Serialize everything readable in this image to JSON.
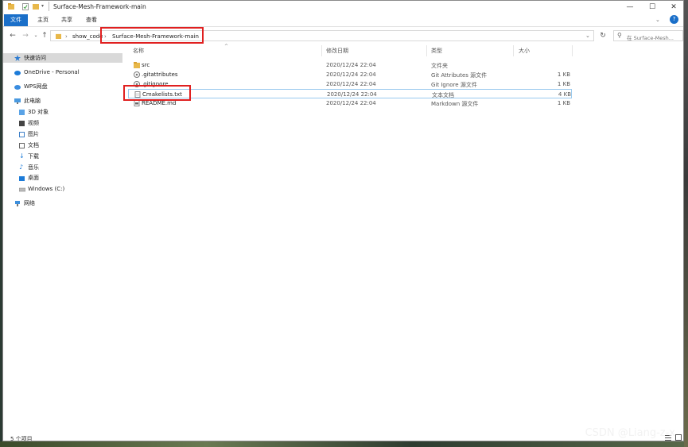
{
  "window": {
    "title": "Surface-Mesh-Framework-main",
    "controls": {
      "minimize": "—",
      "maximize": "☐",
      "close": "✕"
    }
  },
  "ribbon": {
    "tabs": [
      "文件",
      "主页",
      "共享",
      "查看"
    ],
    "help": "?"
  },
  "address": {
    "crumbs": [
      "show_code",
      "Surface-Mesh-Framework-main"
    ],
    "separator": "›",
    "search_placeholder": "在 Surface-Mesh..."
  },
  "nav": {
    "items": [
      {
        "label": "快速访问",
        "icon": "star-icon"
      },
      {
        "label": "OneDrive - Personal",
        "icon": "cloud-icon"
      },
      {
        "label": "WPS网盘",
        "icon": "wps-cloud-icon"
      },
      {
        "label": "此电脑",
        "icon": "computer-icon"
      },
      {
        "label": "3D 对象",
        "icon": "cube-icon"
      },
      {
        "label": "视频",
        "icon": "video-icon"
      },
      {
        "label": "图片",
        "icon": "picture-icon"
      },
      {
        "label": "文档",
        "icon": "document-icon"
      },
      {
        "label": "下载",
        "icon": "download-icon"
      },
      {
        "label": "音乐",
        "icon": "music-icon"
      },
      {
        "label": "桌面",
        "icon": "desktop-icon"
      },
      {
        "label": "Windows (C:)",
        "icon": "drive-icon"
      },
      {
        "label": "网络",
        "icon": "network-icon"
      }
    ]
  },
  "columns": {
    "name": "名称",
    "date": "修改日期",
    "type": "类型",
    "size": "大小"
  },
  "files": [
    {
      "name": "src",
      "date": "2020/12/24 22:04",
      "type": "文件夹",
      "size": "",
      "icon": "folder-icon"
    },
    {
      "name": ".gitattributes",
      "date": "2020/12/24 22:04",
      "type": "Git Attributes 源文件",
      "size": "1 KB",
      "icon": "git-file-icon"
    },
    {
      "name": ".gitignore",
      "date": "2020/12/24 22:04",
      "type": "Git Ignore 源文件",
      "size": "1 KB",
      "icon": "git-file-icon"
    },
    {
      "name": "Cmakelists.txt",
      "date": "2020/12/24 22:04",
      "type": "文本文档",
      "size": "4 KB",
      "icon": "text-file-icon"
    },
    {
      "name": "README.md",
      "date": "2020/12/24 22:04",
      "type": "Markdown 源文件",
      "size": "1 KB",
      "icon": "markdown-file-icon"
    }
  ],
  "status": {
    "count": "5 个项目"
  },
  "watermark": "CSDN @Liang-z-x",
  "colors": {
    "accent": "#1a6fc9",
    "highlight": "#e02020",
    "selection": "#99c9ee",
    "folder": "#e8b84a"
  }
}
